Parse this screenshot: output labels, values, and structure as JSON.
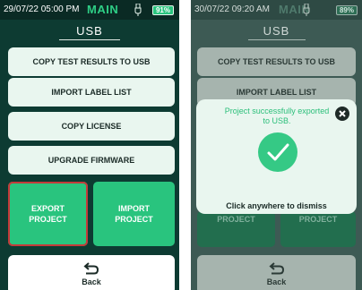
{
  "left_screen": {
    "status": {
      "time": "29/07/22 05:00 PM",
      "mode": "MAIN",
      "battery": "91%"
    },
    "title": "USB",
    "menu": [
      {
        "label": "COPY TEST RESULTS TO USB"
      },
      {
        "label": "IMPORT LABEL LIST"
      },
      {
        "label": "COPY LICENSE"
      },
      {
        "label": "UPGRADE FIRMWARE"
      }
    ],
    "tiles": [
      {
        "label": "EXPORT PROJECT",
        "selected": true
      },
      {
        "label": "IMPORT PROJECT",
        "selected": false
      }
    ],
    "back_label": "Back"
  },
  "right_screen": {
    "status": {
      "time": "30/07/22 09:20 AM",
      "mode": "MAIN",
      "battery": "89%"
    },
    "title": "USB",
    "menu": [
      {
        "label": "COPY TEST RESULTS TO USB"
      },
      {
        "label": "IMPORT LABEL LIST"
      }
    ],
    "tiles": [
      {
        "label": "PROJECT"
      },
      {
        "label": "PROJECT"
      }
    ],
    "back_label": "Back",
    "dialog": {
      "message": "Project successfully exported to USB.",
      "dismiss": "Click anywhere to dismiss"
    }
  },
  "colors": {
    "accent_green": "#29c47e",
    "screen_background": "#0d3b32",
    "selection_outline": "#c43a3a"
  },
  "icons": [
    "usb-icon",
    "battery-icon",
    "back-arrow-icon",
    "close-icon",
    "checkmark-icon"
  ]
}
